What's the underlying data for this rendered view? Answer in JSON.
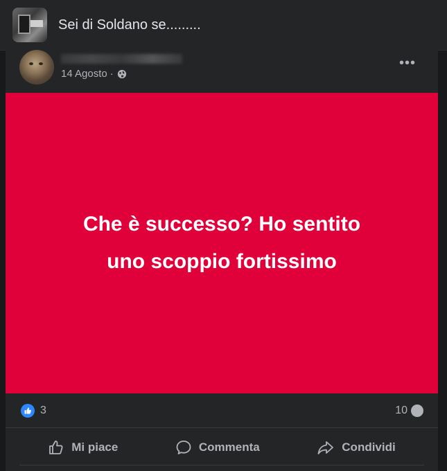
{
  "group": {
    "name": "Sei di Soldano se........."
  },
  "post": {
    "date": "14 Agosto",
    "separator": "·",
    "image_text_line1": "Che è successo? Ho sentito",
    "image_text_line2": "uno scoppio fortissimo",
    "reactions_count": "3",
    "comments_count": "10"
  },
  "actions": {
    "like": "Mi piace",
    "comment": "Commenta",
    "share": "Condividi"
  },
  "colors": {
    "post_background": "#e0003a",
    "like_blue": "#2d88ff",
    "dark_surface": "#242526"
  }
}
